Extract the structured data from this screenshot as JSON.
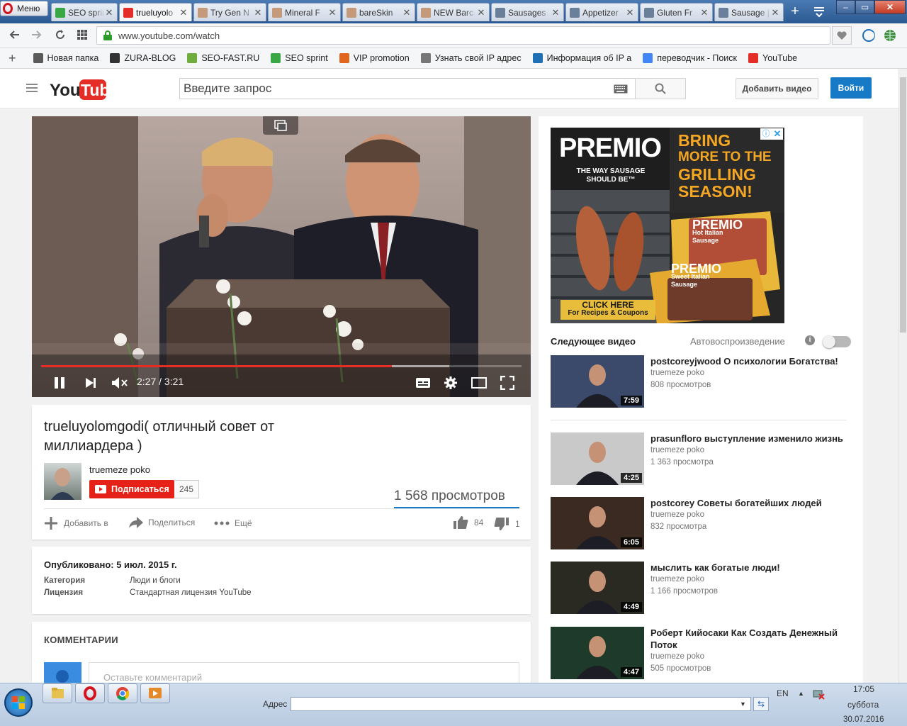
{
  "browser": {
    "menu_label": "Меню",
    "tabs": [
      {
        "label": "SEO sprin",
        "icon_color": "#3aa745",
        "active": false
      },
      {
        "label": "trueluyolo",
        "icon_color": "#e52d27",
        "active": true
      },
      {
        "label": "Try Gen N",
        "icon_color": "#c49a7a",
        "active": false
      },
      {
        "label": "Mineral F",
        "icon_color": "#c49a7a",
        "active": false
      },
      {
        "label": "bareSkin",
        "icon_color": "#c49a7a",
        "active": false
      },
      {
        "label": "NEW Barc",
        "icon_color": "#c49a7a",
        "active": false
      },
      {
        "label": "Sausages",
        "icon_color": "#6a7f99",
        "active": false
      },
      {
        "label": "Appetizer",
        "icon_color": "#6a7f99",
        "active": false
      },
      {
        "label": "Gluten Fr",
        "icon_color": "#6a7f99",
        "active": false
      },
      {
        "label": "Sausage |",
        "icon_color": "#6a7f99",
        "active": false
      }
    ],
    "url": "www.youtube.com/watch",
    "bookmarks": [
      {
        "label": "Новая папка",
        "icon": "folder-icon",
        "color": "#5a5a5a"
      },
      {
        "label": "ZURA-BLOG",
        "icon": "zura-icon",
        "color": "#333"
      },
      {
        "label": "SEO-FAST.RU",
        "icon": "sf-icon",
        "color": "#6fae3d"
      },
      {
        "label": "SEO sprint",
        "icon": "seosprint-icon",
        "color": "#3aa745"
      },
      {
        "label": "VIP promotion",
        "icon": "vip-icon",
        "color": "#e0671d"
      },
      {
        "label": "Узнать свой IP адрес",
        "icon": "search-icon",
        "color": "#777"
      },
      {
        "label": "Информация об IP а",
        "icon": "ip-icon",
        "color": "#1f6fb5"
      },
      {
        "label": "переводчик - Поиск",
        "icon": "google-icon",
        "color": "#4285f4"
      },
      {
        "label": "YouTube",
        "icon": "youtube-icon",
        "color": "#e52d27"
      }
    ]
  },
  "youtube": {
    "search_placeholder": "Введите запрос",
    "upload_label": "Добавить видео",
    "signin_label": "Войти",
    "player": {
      "time": "2:27 / 3:21",
      "progress": 0.73,
      "buffered": 0.85
    },
    "video": {
      "title_line1": "trueluyolomgodi( отличный совет от",
      "title_line2": "миллиардера )",
      "channel": "truemeze poko",
      "subscribe_label": "Подписаться",
      "subscriber_count": "245",
      "views": "1 568 просмотров",
      "add_to_label": "Добавить в",
      "share_label": "Поделиться",
      "more_label": "Ещё",
      "likes": "84",
      "dislikes": "1"
    },
    "description": {
      "published": "Опубликовано: 5 июл. 2015 г.",
      "category_label": "Категория",
      "category_value": "Люди и блоги",
      "license_label": "Лицензия",
      "license_value": "Стандартная лицензия YouTube"
    },
    "comments": {
      "heading": "КОММЕНТАРИИ",
      "placeholder": "Оставьте комментарий"
    },
    "ad": {
      "brand": "PREMIO",
      "tagline": "THE WAY SAUSAGE SHOULD BE™",
      "headline": [
        "BRING",
        "MORE TO THE",
        "GRILLING",
        "SEASON!"
      ],
      "package1": "Hot Italian Sausage",
      "package2": "Sweet Italian Sausage",
      "cta_line1": "CLICK HERE",
      "cta_line2": "For Recipes & Coupons"
    },
    "up_next_label": "Следующее видео",
    "autoplay_label": "Автовоспроизведение",
    "related": [
      {
        "title": "postcoreyjwood О психологии Богатства!",
        "channel": "truemeze poko",
        "views": "808 просмотров",
        "duration": "7:59",
        "thumb": "#3b4a6b"
      },
      {
        "title": "prasunfloro выступление изменило жизнь",
        "channel": "truemeze poko",
        "views": "1 363 просмотра",
        "duration": "4:25",
        "thumb": "#c9c9c9"
      },
      {
        "title": "postcorey Советы богатейших людей",
        "channel": "truemeze poko",
        "views": "832 просмотра",
        "duration": "6:05",
        "thumb": "#3a2a22"
      },
      {
        "title": "мыслить как богатые люди!",
        "channel": "truemeze poko",
        "views": "1 166 просмотров",
        "duration": "4:49",
        "thumb": "#2b2a22"
      },
      {
        "title": "Роберт Кийосаки Как Создать Денежный Поток",
        "channel": "truemeze poko",
        "views": "505 просмотров",
        "duration": "4:47",
        "thumb": "#1e3a2a"
      }
    ]
  },
  "taskbar": {
    "address_label": "Адрес",
    "lang": "EN",
    "time": "17:05",
    "day": "суббота",
    "date": "30.07.2016"
  }
}
